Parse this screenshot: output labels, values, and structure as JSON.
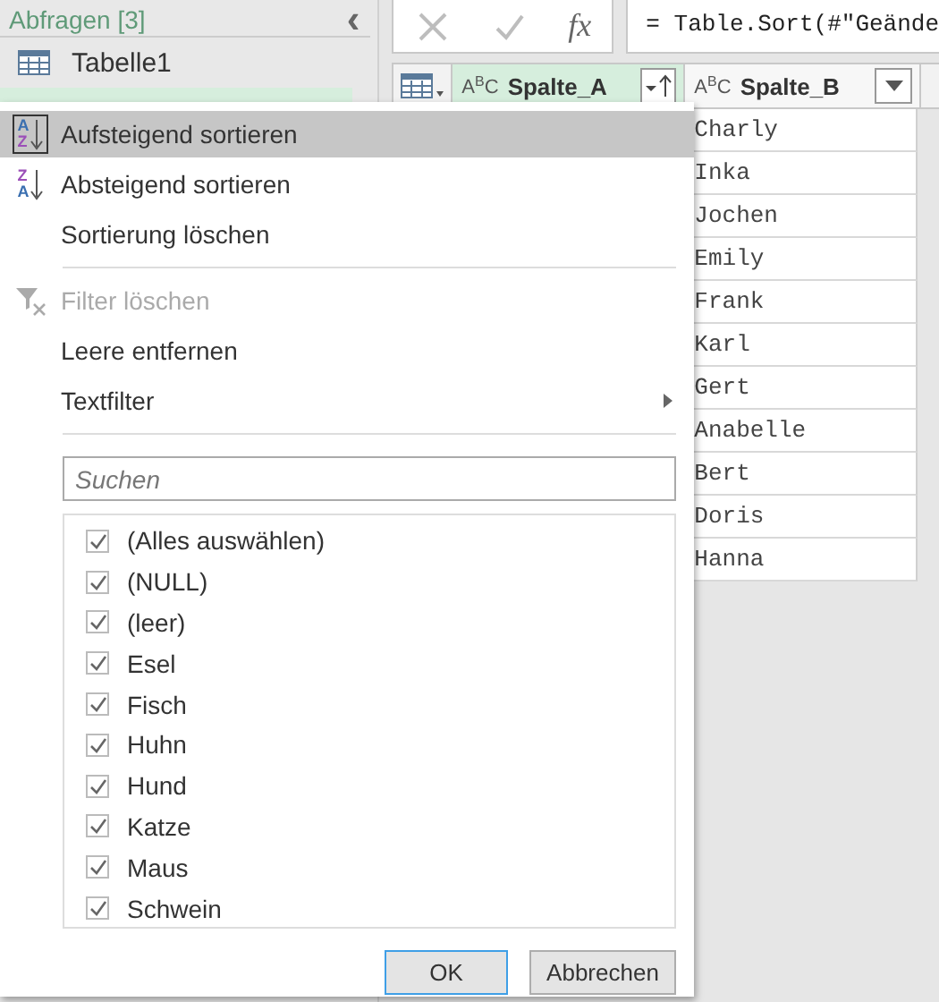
{
  "sidebar": {
    "header": "Abfragen [3]",
    "collapse_glyph": "‹",
    "items": [
      {
        "label": "Tabelle1",
        "selected": false
      },
      {
        "selected": true
      }
    ]
  },
  "formula_bar": {
    "fx": "fx",
    "formula": "= Table.Sort(#\"Geände"
  },
  "table": {
    "columns": [
      {
        "name": "Spalte_A",
        "type_glyph": [
          "A",
          "B",
          "C"
        ],
        "selected": true,
        "kind": "sorted"
      },
      {
        "name": "Spalte_B",
        "type_glyph": [
          "A",
          "B",
          "C"
        ],
        "selected": false,
        "kind": "plain"
      }
    ],
    "rows": [
      "Charly",
      "Inka",
      "Jochen",
      "Emily",
      "Frank",
      "Karl",
      "Gert",
      "Anabelle",
      "Bert",
      "Doris",
      "Hanna"
    ]
  },
  "menu": {
    "items": [
      {
        "kind": "ascending",
        "label": "Aufsteigend sortieren",
        "icon_letters": [
          "A",
          "Z"
        ],
        "highlighted": true,
        "disabled": false
      },
      {
        "kind": "descending",
        "label": "Absteigend sortieren",
        "icon_letters": [
          "Z",
          "A"
        ],
        "highlighted": false,
        "disabled": false
      },
      {
        "kind": "plain",
        "label": "Sortierung löschen",
        "highlighted": false,
        "disabled": false
      },
      {
        "kind": "separator"
      },
      {
        "kind": "clearfilter",
        "label": "Filter löschen",
        "highlighted": false,
        "disabled": true
      },
      {
        "kind": "plain",
        "label": "Leere entfernen",
        "highlighted": false,
        "disabled": false
      },
      {
        "kind": "submenu",
        "label": "Textfilter",
        "highlighted": false,
        "disabled": false
      },
      {
        "kind": "separator"
      }
    ],
    "search": {
      "placeholder": "Suchen"
    },
    "values": [
      {
        "label": "(Alles auswählen)",
        "checked": true
      },
      {
        "label": "(NULL)",
        "checked": true
      },
      {
        "label": "(leer)",
        "checked": true
      },
      {
        "label": "Esel",
        "checked": true
      },
      {
        "label": "Fisch",
        "checked": true
      },
      {
        "label": "Huhn",
        "checked": true
      },
      {
        "label": "Hund",
        "checked": true
      },
      {
        "label": "Katze",
        "checked": true
      },
      {
        "label": "Maus",
        "checked": true
      },
      {
        "label": "Schwein",
        "checked": true
      }
    ],
    "buttons": [
      {
        "label": "OK",
        "default": true
      },
      {
        "label": "Abbrechen",
        "default": false
      }
    ]
  }
}
